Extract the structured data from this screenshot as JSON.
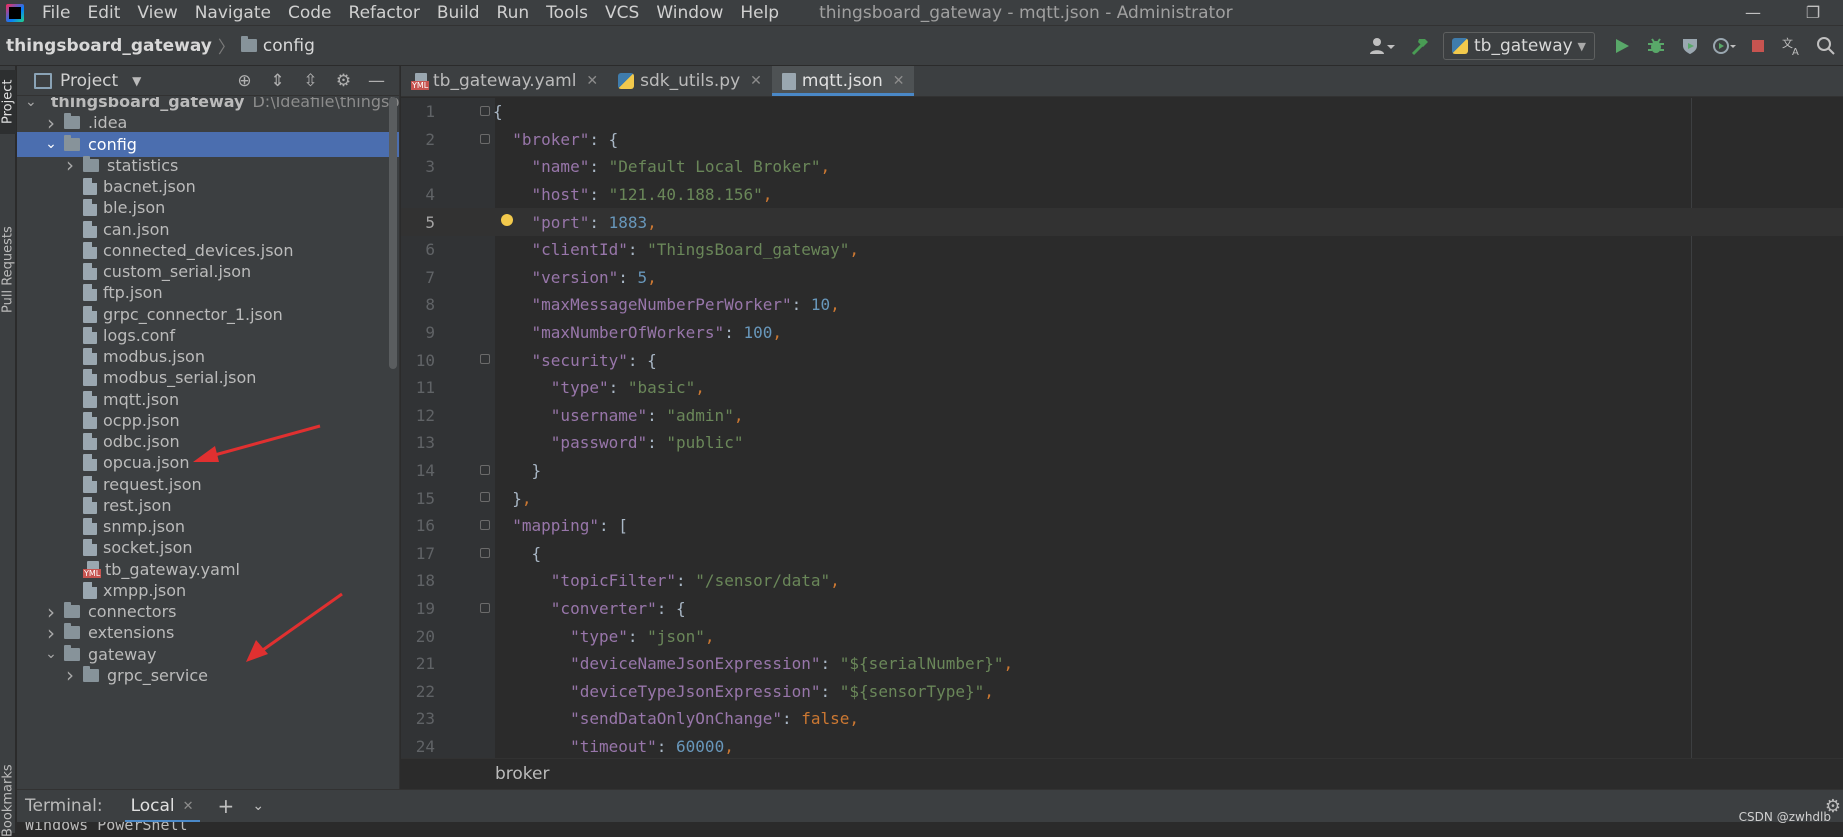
{
  "menubar": {
    "items": [
      "File",
      "Edit",
      "View",
      "Navigate",
      "Code",
      "Refactor",
      "Build",
      "Run",
      "Tools",
      "VCS",
      "Window",
      "Help"
    ],
    "window_title": "thingsboard_gateway - mqtt.json - Administrator"
  },
  "navbar": {
    "root": "thingsboard_gateway",
    "folder": "config",
    "run_config": "tb_gateway"
  },
  "left_stripe": {
    "project": "Project",
    "pull_requests": "Pull Requests",
    "bookmarks": "Bookmarks"
  },
  "project_panel": {
    "title": "Project",
    "tree": [
      {
        "label": "thingsboard_gateway",
        "path": "D:\\Ideafile\\thingsboard_gateway",
        "kind": "root-folder",
        "depth": 0,
        "expanded": true
      },
      {
        "label": ".idea",
        "kind": "folder",
        "depth": 1,
        "expanded": false
      },
      {
        "label": "config",
        "kind": "folder",
        "depth": 1,
        "expanded": true,
        "selected": true
      },
      {
        "label": "statistics",
        "kind": "folder",
        "depth": 2,
        "expanded": false
      },
      {
        "label": "bacnet.json",
        "kind": "file",
        "depth": 2
      },
      {
        "label": "ble.json",
        "kind": "file",
        "depth": 2
      },
      {
        "label": "can.json",
        "kind": "file",
        "depth": 2
      },
      {
        "label": "connected_devices.json",
        "kind": "file",
        "depth": 2
      },
      {
        "label": "custom_serial.json",
        "kind": "file",
        "depth": 2
      },
      {
        "label": "ftp.json",
        "kind": "file",
        "depth": 2
      },
      {
        "label": "grpc_connector_1.json",
        "kind": "file",
        "depth": 2
      },
      {
        "label": "logs.conf",
        "kind": "file",
        "depth": 2
      },
      {
        "label": "modbus.json",
        "kind": "file",
        "depth": 2
      },
      {
        "label": "modbus_serial.json",
        "kind": "file",
        "depth": 2
      },
      {
        "label": "mqtt.json",
        "kind": "file",
        "depth": 2
      },
      {
        "label": "ocpp.json",
        "kind": "file",
        "depth": 2
      },
      {
        "label": "odbc.json",
        "kind": "file",
        "depth": 2
      },
      {
        "label": "opcua.json",
        "kind": "file",
        "depth": 2
      },
      {
        "label": "request.json",
        "kind": "file",
        "depth": 2
      },
      {
        "label": "rest.json",
        "kind": "file",
        "depth": 2
      },
      {
        "label": "snmp.json",
        "kind": "file",
        "depth": 2
      },
      {
        "label": "socket.json",
        "kind": "file",
        "depth": 2
      },
      {
        "label": "tb_gateway.yaml",
        "kind": "yml",
        "depth": 2
      },
      {
        "label": "xmpp.json",
        "kind": "file",
        "depth": 2
      },
      {
        "label": "connectors",
        "kind": "folder",
        "depth": 1,
        "expanded": false
      },
      {
        "label": "extensions",
        "kind": "folder",
        "depth": 1,
        "expanded": false
      },
      {
        "label": "gateway",
        "kind": "folder",
        "depth": 1,
        "expanded": true
      },
      {
        "label": "grpc_service",
        "kind": "folder",
        "depth": 2,
        "expanded": false
      }
    ]
  },
  "editor": {
    "tabs": [
      {
        "label": "tb_gateway.yaml",
        "kind": "yml"
      },
      {
        "label": "sdk_utils.py",
        "kind": "py"
      },
      {
        "label": "mqtt.json",
        "kind": "json",
        "active": true
      }
    ],
    "current_line": 5,
    "lines": [
      [
        {
          "t": "{",
          "c": "t"
        }
      ],
      [
        {
          "t": "  ",
          "c": "t"
        },
        {
          "t": "\"broker\"",
          "c": "k"
        },
        {
          "t": ": {",
          "c": "t"
        }
      ],
      [
        {
          "t": "    ",
          "c": "t"
        },
        {
          "t": "\"name\"",
          "c": "k"
        },
        {
          "t": ": ",
          "c": "t"
        },
        {
          "t": "\"Default Local Broker\"",
          "c": "s"
        },
        {
          "t": ",",
          "c": "p"
        }
      ],
      [
        {
          "t": "    ",
          "c": "t"
        },
        {
          "t": "\"host\"",
          "c": "k"
        },
        {
          "t": ": ",
          "c": "t"
        },
        {
          "t": "\"121.40.188.156\"",
          "c": "s"
        },
        {
          "t": ",",
          "c": "p"
        }
      ],
      [
        {
          "t": "    ",
          "c": "t"
        },
        {
          "t": "\"port\"",
          "c": "k"
        },
        {
          "t": ": ",
          "c": "t"
        },
        {
          "t": "1883",
          "c": "n"
        },
        {
          "t": ",",
          "c": "p"
        }
      ],
      [
        {
          "t": "    ",
          "c": "t"
        },
        {
          "t": "\"clientId\"",
          "c": "k"
        },
        {
          "t": ": ",
          "c": "t"
        },
        {
          "t": "\"ThingsBoard_gateway\"",
          "c": "s"
        },
        {
          "t": ",",
          "c": "p"
        }
      ],
      [
        {
          "t": "    ",
          "c": "t"
        },
        {
          "t": "\"version\"",
          "c": "k"
        },
        {
          "t": ": ",
          "c": "t"
        },
        {
          "t": "5",
          "c": "n"
        },
        {
          "t": ",",
          "c": "p"
        }
      ],
      [
        {
          "t": "    ",
          "c": "t"
        },
        {
          "t": "\"maxMessageNumberPerWorker\"",
          "c": "k"
        },
        {
          "t": ": ",
          "c": "t"
        },
        {
          "t": "10",
          "c": "n"
        },
        {
          "t": ",",
          "c": "p"
        }
      ],
      [
        {
          "t": "    ",
          "c": "t"
        },
        {
          "t": "\"maxNumberOfWorkers\"",
          "c": "k"
        },
        {
          "t": ": ",
          "c": "t"
        },
        {
          "t": "100",
          "c": "n"
        },
        {
          "t": ",",
          "c": "p"
        }
      ],
      [
        {
          "t": "    ",
          "c": "t"
        },
        {
          "t": "\"security\"",
          "c": "k"
        },
        {
          "t": ": {",
          "c": "t"
        }
      ],
      [
        {
          "t": "      ",
          "c": "t"
        },
        {
          "t": "\"type\"",
          "c": "k"
        },
        {
          "t": ": ",
          "c": "t"
        },
        {
          "t": "\"basic\"",
          "c": "s"
        },
        {
          "t": ",",
          "c": "p"
        }
      ],
      [
        {
          "t": "      ",
          "c": "t"
        },
        {
          "t": "\"username\"",
          "c": "k"
        },
        {
          "t": ": ",
          "c": "t"
        },
        {
          "t": "\"admin\"",
          "c": "s"
        },
        {
          "t": ",",
          "c": "p"
        }
      ],
      [
        {
          "t": "      ",
          "c": "t"
        },
        {
          "t": "\"password\"",
          "c": "k"
        },
        {
          "t": ": ",
          "c": "t"
        },
        {
          "t": "\"public\"",
          "c": "s"
        }
      ],
      [
        {
          "t": "    }",
          "c": "t"
        }
      ],
      [
        {
          "t": "  }",
          "c": "t"
        },
        {
          "t": ",",
          "c": "p"
        }
      ],
      [
        {
          "t": "  ",
          "c": "t"
        },
        {
          "t": "\"mapping\"",
          "c": "k"
        },
        {
          "t": ": [",
          "c": "t"
        }
      ],
      [
        {
          "t": "    {",
          "c": "t"
        }
      ],
      [
        {
          "t": "      ",
          "c": "t"
        },
        {
          "t": "\"topicFilter\"",
          "c": "k"
        },
        {
          "t": ": ",
          "c": "t"
        },
        {
          "t": "\"/sensor/data\"",
          "c": "s"
        },
        {
          "t": ",",
          "c": "p"
        }
      ],
      [
        {
          "t": "      ",
          "c": "t"
        },
        {
          "t": "\"converter\"",
          "c": "k"
        },
        {
          "t": ": {",
          "c": "t"
        }
      ],
      [
        {
          "t": "        ",
          "c": "t"
        },
        {
          "t": "\"type\"",
          "c": "k"
        },
        {
          "t": ": ",
          "c": "t"
        },
        {
          "t": "\"json\"",
          "c": "s"
        },
        {
          "t": ",",
          "c": "p"
        }
      ],
      [
        {
          "t": "        ",
          "c": "t"
        },
        {
          "t": "\"deviceNameJsonExpression\"",
          "c": "k"
        },
        {
          "t": ": ",
          "c": "t"
        },
        {
          "t": "\"${serialNumber}\"",
          "c": "s"
        },
        {
          "t": ",",
          "c": "p"
        }
      ],
      [
        {
          "t": "        ",
          "c": "t"
        },
        {
          "t": "\"deviceTypeJsonExpression\"",
          "c": "k"
        },
        {
          "t": ": ",
          "c": "t"
        },
        {
          "t": "\"${sensorType}\"",
          "c": "s"
        },
        {
          "t": ",",
          "c": "p"
        }
      ],
      [
        {
          "t": "        ",
          "c": "t"
        },
        {
          "t": "\"sendDataOnlyOnChange\"",
          "c": "k"
        },
        {
          "t": ": ",
          "c": "t"
        },
        {
          "t": "false",
          "c": "b"
        },
        {
          "t": ",",
          "c": "p"
        }
      ],
      [
        {
          "t": "        ",
          "c": "t"
        },
        {
          "t": "\"timeout\"",
          "c": "k"
        },
        {
          "t": ": ",
          "c": "t"
        },
        {
          "t": "60000",
          "c": "n"
        },
        {
          "t": ",",
          "c": "p"
        }
      ]
    ],
    "fold_lines": [
      1,
      2,
      10,
      14,
      15,
      16,
      17,
      19
    ],
    "breadcrumb": "broker"
  },
  "terminal": {
    "title": "Terminal:",
    "tab": "Local",
    "line": "Windows PowerShell"
  },
  "watermark": "CSDN @zwhdlb",
  "colors": {
    "selection": "#4b6eaf",
    "accent": "#4a88c7",
    "arrow": "#e03030"
  }
}
